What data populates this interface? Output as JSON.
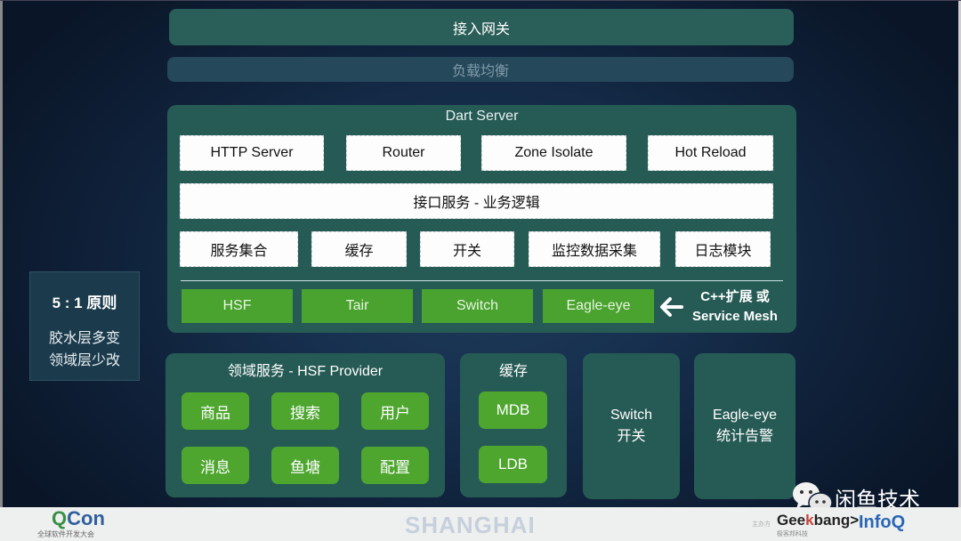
{
  "top": {
    "gateway": "接入网关",
    "load_balance": "负载均衡"
  },
  "dart_server": {
    "title": "Dart Server",
    "row1": [
      "HTTP Server",
      "Router",
      "Zone Isolate",
      "Hot Reload"
    ],
    "interface": "接口服务 - 业务逻辑",
    "row3": [
      "服务集合",
      "缓存",
      "开关",
      "监控数据采集",
      "日志模块"
    ],
    "adapters": [
      "HSF",
      "Tair",
      "Switch",
      "Eagle-eye"
    ],
    "extension_line1": "C++扩展 或",
    "extension_line2": "Service Mesh"
  },
  "principle": {
    "title": "5 : 1 原则",
    "line1": "胶水层多变",
    "line2": "领域层少改"
  },
  "domain_services": {
    "title": "领域服务 - HSF Provider",
    "tiles": [
      "商品",
      "搜索",
      "用户",
      "消息",
      "鱼塘",
      "配置"
    ]
  },
  "cache": {
    "title": "缓存",
    "tiles": [
      "MDB",
      "LDB"
    ]
  },
  "switch_panel": {
    "line1": "Switch",
    "line2": "开关"
  },
  "eagle_panel": {
    "line1": "Eagle-eye",
    "line2": "统计告警"
  },
  "watermark": {
    "text": "闲鱼技术",
    "icon": "wechat-icon"
  },
  "footer": {
    "qcon_q": "Q",
    "qcon_con": "Con",
    "qcon_sub": "全球软件开发大会",
    "city": "SHANGHAI",
    "host_label": "主办方",
    "geek_a": "Gee",
    "geek_k": "k",
    "geek_b": "bang>.",
    "geek_sub": "极客邦科技",
    "infoq": "InfoQ"
  },
  "colors": {
    "panel_teal": "#265b55",
    "green": "#4aa22f",
    "background": "#17304f"
  }
}
